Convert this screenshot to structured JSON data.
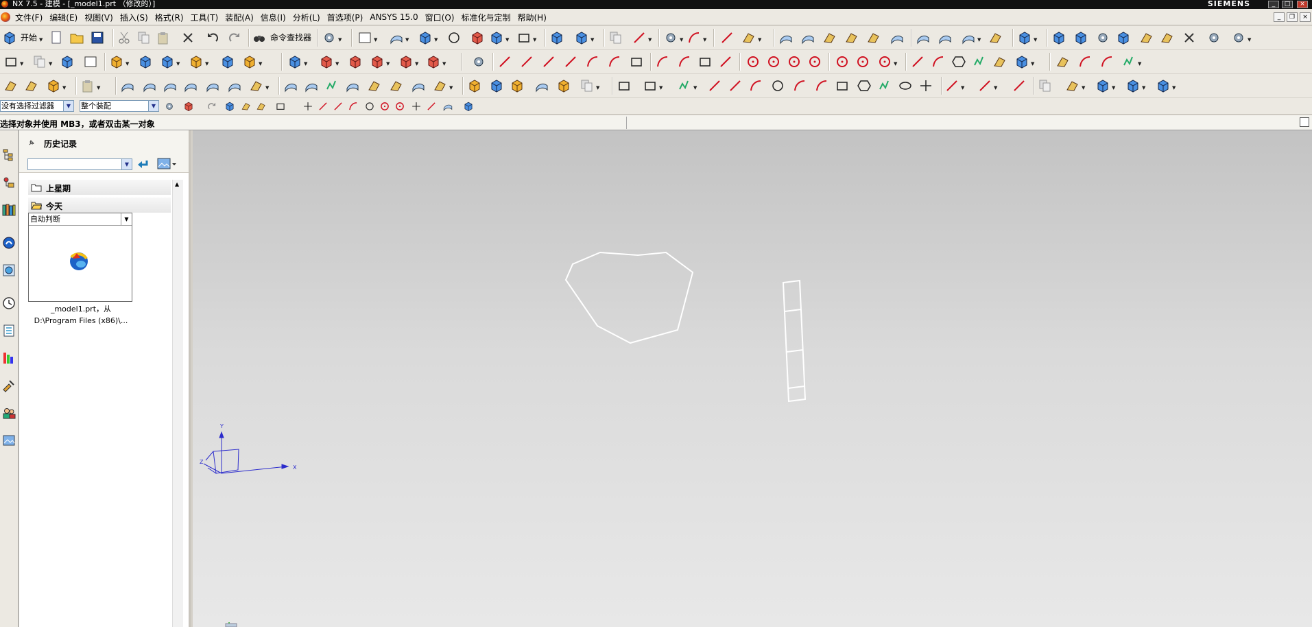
{
  "window": {
    "title": "NX 7.5 - 建模 - [_model1.prt （修改的）]",
    "brand": "SIEMENS"
  },
  "menu": {
    "items": [
      "文件(F)",
      "编辑(E)",
      "视图(V)",
      "插入(S)",
      "格式(R)",
      "工具(T)",
      "装配(A)",
      "信息(I)",
      "分析(L)",
      "首选项(P)",
      "ANSYS 15.0",
      "窗口(O)",
      "标准化与定制",
      "帮助(H)"
    ]
  },
  "toolbar": {
    "start_label": "开始",
    "command_finder_label": "命令查找器"
  },
  "selection": {
    "filter_value": "没有选择过滤器",
    "scope_value": "整个装配"
  },
  "status": {
    "cue": "选择对象并使用 MB3，或者双击某一对象"
  },
  "navigator": {
    "title": "历史记录",
    "search_value": "",
    "groups": [
      {
        "label": "上星期"
      },
      {
        "label": "今天"
      }
    ],
    "history_item": {
      "filter_value": "自动判断",
      "caption_line1": "_model1.prt，从",
      "caption_line2": "D:\\Program Files (x86)\\..."
    }
  },
  "viewport": {
    "triad": {
      "x_label": "X",
      "y_label": "Y",
      "z_label": "Z"
    }
  },
  "colors": {
    "toolbar_bg": "#ece9e2",
    "titlebar_bg": "#111111",
    "geometry": "#ffffff",
    "triad": "#2c2ccc"
  }
}
